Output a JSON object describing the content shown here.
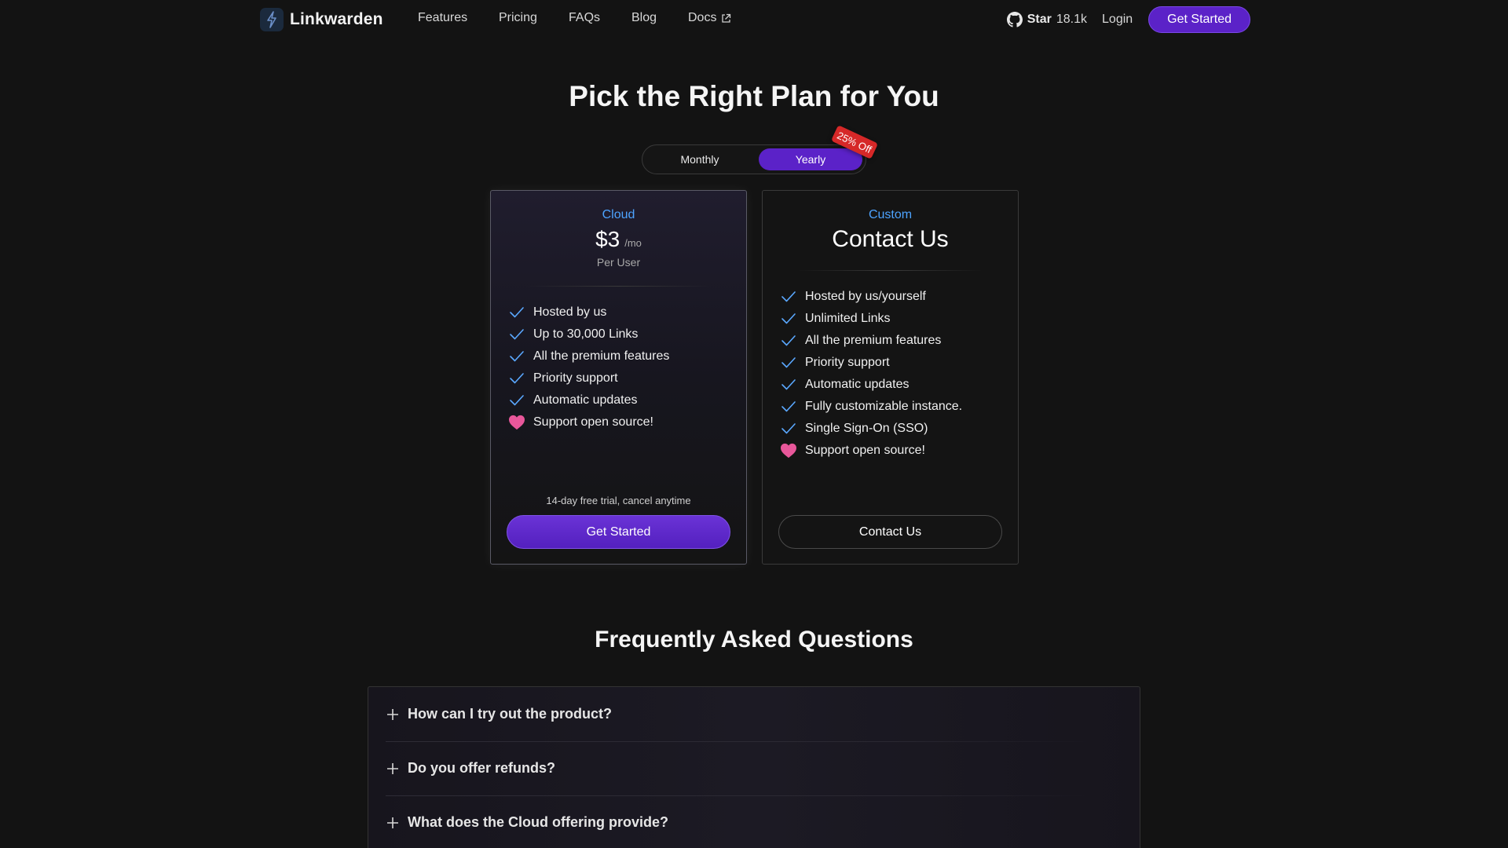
{
  "nav": {
    "brand": "Linkwarden",
    "links": [
      "Features",
      "Pricing",
      "FAQs",
      "Blog",
      "Docs"
    ],
    "github_star_label": "Star",
    "github_star_count": "18.1k",
    "login": "Login",
    "cta": "Get Started"
  },
  "pricing": {
    "title": "Pick the Right Plan for You",
    "billing_toggle": {
      "options": [
        "Monthly",
        "Yearly"
      ],
      "selected": "Yearly",
      "badge": "25% Off"
    },
    "plans": [
      {
        "name": "Cloud",
        "price": "$3",
        "price_unit": "/mo",
        "price_note": "Per User",
        "features": [
          {
            "icon": "check-icon",
            "text": "Hosted by us"
          },
          {
            "icon": "check-icon",
            "text": "Up to 30,000 Links"
          },
          {
            "icon": "check-icon",
            "text": "All the premium features"
          },
          {
            "icon": "check-icon",
            "text": "Priority support"
          },
          {
            "icon": "check-icon",
            "text": "Automatic updates"
          },
          {
            "icon": "heart-icon",
            "text": "Support open source!"
          }
        ],
        "note": "14-day free trial, cancel anytime",
        "button": "Get Started"
      },
      {
        "name": "Custom",
        "headline": "Contact Us",
        "features": [
          {
            "icon": "check-icon",
            "text": "Hosted by us/yourself"
          },
          {
            "icon": "check-icon",
            "text": "Unlimited Links"
          },
          {
            "icon": "check-icon",
            "text": "All the premium features"
          },
          {
            "icon": "check-icon",
            "text": "Priority support"
          },
          {
            "icon": "check-icon",
            "text": "Automatic updates"
          },
          {
            "icon": "check-icon",
            "text": "Fully customizable instance."
          },
          {
            "icon": "check-icon",
            "text": "Single Sign-On (SSO)"
          },
          {
            "icon": "heart-icon",
            "text": "Support open source!"
          }
        ],
        "button": "Contact Us"
      }
    ]
  },
  "faq": {
    "title": "Frequently Asked Questions",
    "items": [
      "How can I try out the product?",
      "Do you offer refunds?",
      "What does the Cloud offering provide?"
    ]
  },
  "colors": {
    "background": "#131313",
    "accent_purple": "#5b22c8",
    "plan_name_blue": "#4da3ff",
    "check_blue": "#5aa8ff",
    "heart_pink": "#e8579a",
    "badge_red": "#d62828"
  }
}
